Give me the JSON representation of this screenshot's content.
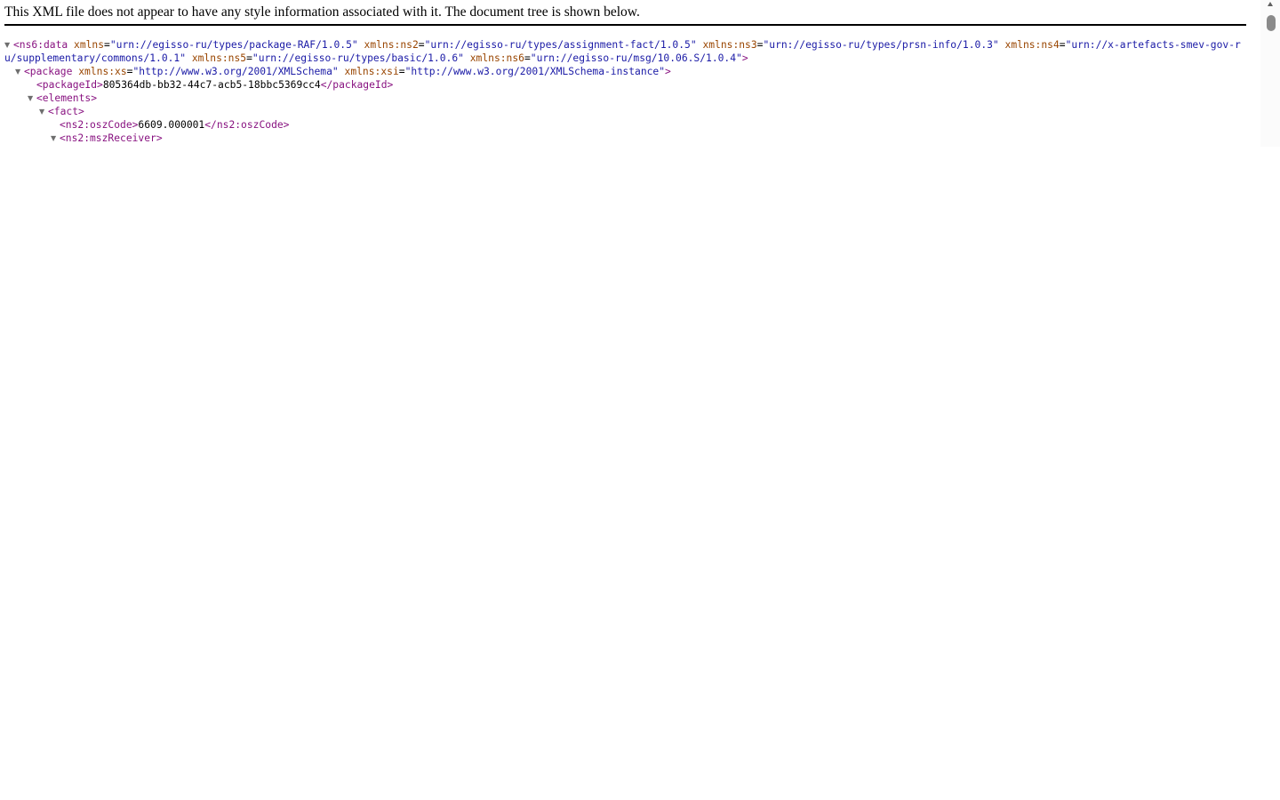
{
  "header": {
    "message": "This XML file does not appear to have any style information associated with it. The document tree is shown below."
  },
  "tree": {
    "root": {
      "open": "<ns6:data",
      "attrs": [
        {
          "name": "xmlns",
          "value": "\"urn://egisso-ru/types/package-RAF/1.0.5\""
        },
        {
          "name": "xmlns:ns2",
          "value": "\"urn://egisso-ru/types/assignment-fact/1.0.5\""
        },
        {
          "name": "xmlns:ns3",
          "value": "\"urn://egisso-ru/types/prsn-info/1.0.3\""
        },
        {
          "name": "xmlns:ns4",
          "value": "\"urn://x-artefacts-smev-gov-ru/supplementary/commons/1.0.1\""
        },
        {
          "name": "xmlns:ns5",
          "value": "\"urn://egisso-ru/types/basic/1.0.6\""
        },
        {
          "name": "xmlns:ns6",
          "value": "\"urn://egisso-ru/msg/10.06.S/1.0.4\""
        }
      ],
      "close": ">"
    },
    "package": {
      "open": "<package",
      "attrs": [
        {
          "name": "xmlns:xs",
          "value": "\"http://www.w3.org/2001/XMLSchema\""
        },
        {
          "name": "xmlns:xsi",
          "value": "\"http://www.w3.org/2001/XMLSchema-instance\""
        }
      ],
      "close": ">"
    },
    "packageId": {
      "open": "<packageId>",
      "value": "805364db-bb32-44c7-acb5-18bbc5369cc4",
      "close": "</packageId>"
    },
    "elements": {
      "open": "<elements>"
    },
    "fact": {
      "open": "<fact>"
    },
    "oszCode": {
      "open": "<ns2:oszCode>",
      "value": "6609.000001",
      "close": "</ns2:oszCode>"
    },
    "mszReceiver": {
      "open": "<ns2:mszReceiver>"
    },
    "toggle_glyph": "▼"
  },
  "colors": {
    "tag": "#881280",
    "attr_name": "#994500",
    "attr_value": "#1a1aa6"
  }
}
